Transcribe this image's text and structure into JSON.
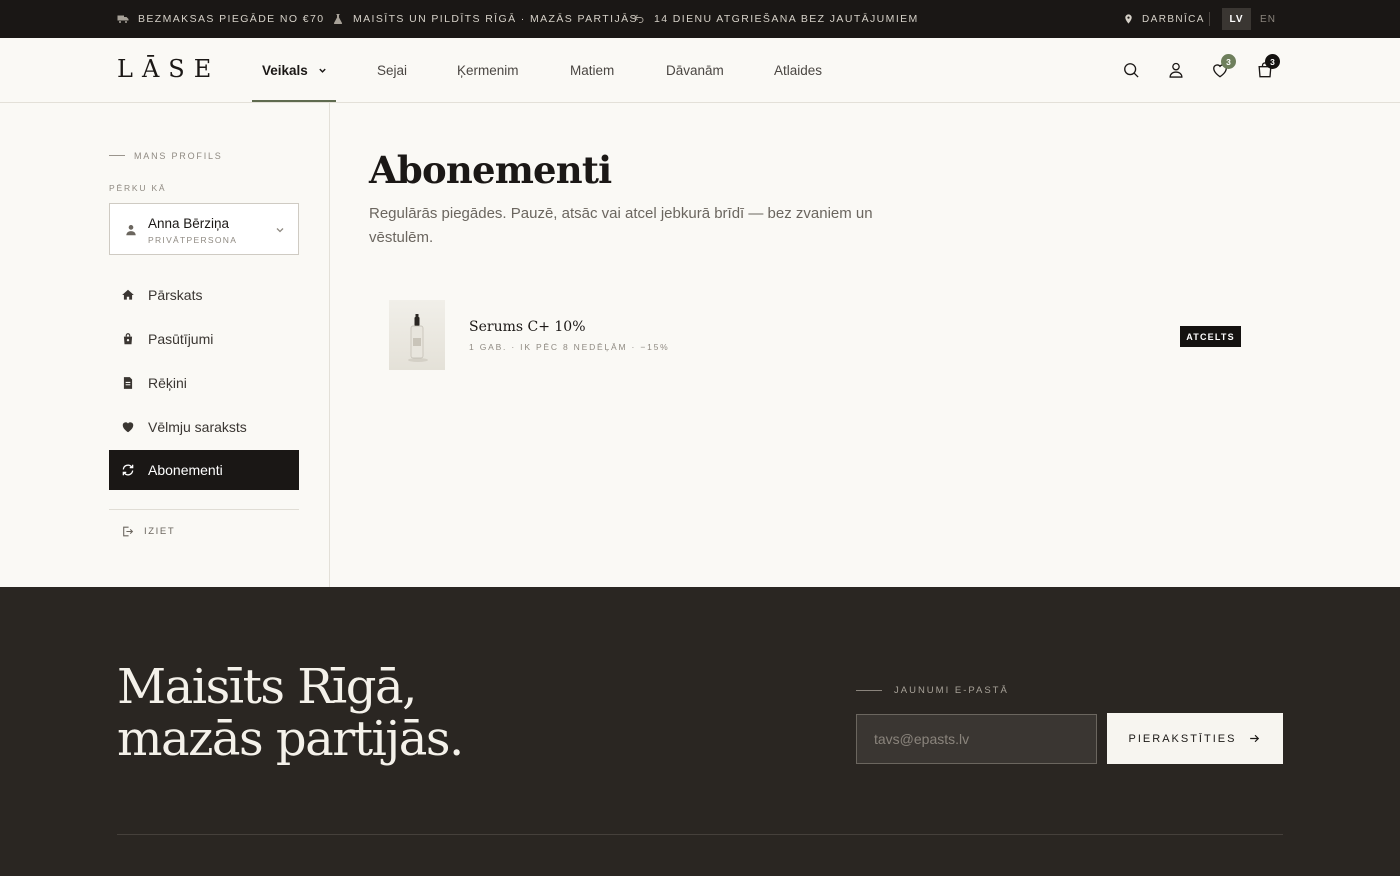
{
  "announcements": {
    "shipping": "BEZMAKSAS PIEGĀDE NO €70",
    "made": "MAISĪTS UN PILDĪTS RĪGĀ · MAZĀS PARTIJĀS",
    "returns": "14 DIENU ATGRIEŠANA BEZ JAUTĀJUMIEM",
    "location": "DARBNĪCA",
    "lang_lv": "LV",
    "lang_en": "EN"
  },
  "header": {
    "logo": "LĀSE",
    "nav": [
      "Veikals",
      "Sejai",
      "Ķermenim",
      "Matiem",
      "Dāvanām",
      "Atlaides"
    ],
    "wishlist_count": "3",
    "cart_count": "3",
    "icons": [
      "search-icon",
      "user-icon",
      "heart-icon",
      "bag-icon"
    ]
  },
  "sidebar": {
    "section_label": "MANS PROFILS",
    "buy_as_label": "PĒRKU KĀ",
    "profile_name": "Anna Bērziņa",
    "profile_type": "PRIVĀTPERSONA",
    "items": [
      {
        "label": "Pārskats",
        "icon": "home-icon"
      },
      {
        "label": "Pasūtījumi",
        "icon": "shopping-bag-icon"
      },
      {
        "label": "Rēķini",
        "icon": "document-icon"
      },
      {
        "label": "Vēlmju saraksts",
        "icon": "heart-icon"
      },
      {
        "label": "Abonementi",
        "icon": "refresh-icon",
        "active": true
      }
    ],
    "logout": "IZIET"
  },
  "main": {
    "title": "Abonementi",
    "description": "Regulārās piegādes. Pauzē, atsāc vai atcel jebkurā brīdī — bez zvaniem un vēstulēm.",
    "subscriptions": [
      {
        "name": "Serums C+ 10%",
        "meta": "1 GAB. · IK PĒC 8 NEDĒĻĀM · −15%",
        "status": "ATCELTS"
      }
    ]
  },
  "footer": {
    "headline_1": "Maisīts Rīgā,",
    "headline_2": "mazās partijās.",
    "newsletter_label": "JAUNUMI E-PASTĀ",
    "email_placeholder": "tavs@epasts.lv",
    "subscribe_label": "PIERAKSTĪTIES"
  },
  "colors": {
    "dark": "#1a1715",
    "accent_green": "#6e7f5c",
    "background": "#faf9f5",
    "footer": "#2a2622"
  }
}
